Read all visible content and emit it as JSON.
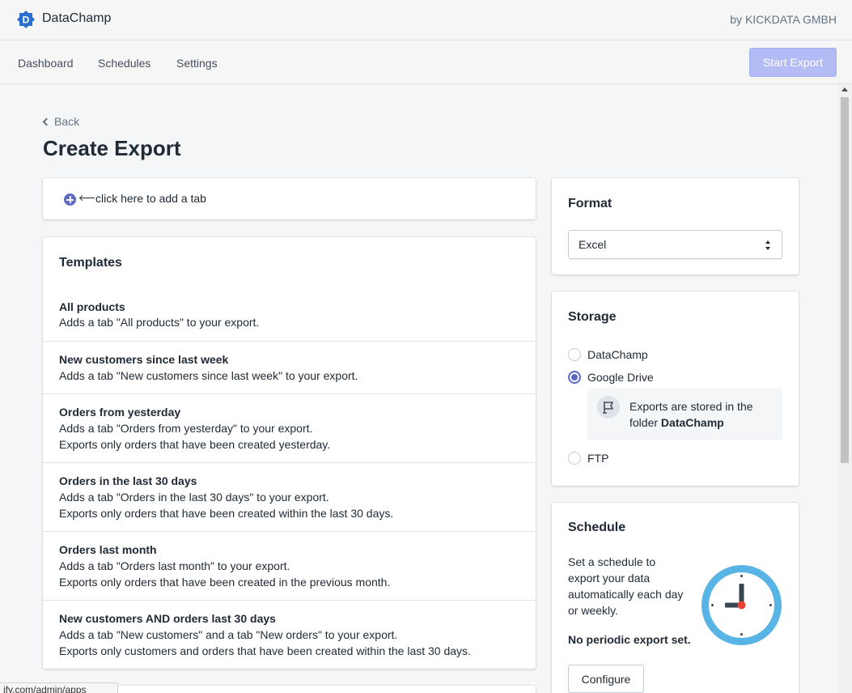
{
  "header": {
    "app_title": "DataChamp",
    "vendor": "by KICKDATA GMBH"
  },
  "nav": {
    "items": [
      {
        "label": "Dashboard"
      },
      {
        "label": "Schedules"
      },
      {
        "label": "Settings"
      }
    ],
    "start_export": "Start Export"
  },
  "page": {
    "back": "Back",
    "title": "Create Export"
  },
  "add_tab": {
    "hint": "click here to add a tab"
  },
  "templates": {
    "title": "Templates",
    "items": [
      {
        "name": "All products",
        "lines": [
          "Adds a tab \"All products\" to your export."
        ]
      },
      {
        "name": "New customers since last week",
        "lines": [
          "Adds a tab \"New customers since last week\" to your export."
        ]
      },
      {
        "name": "Orders from yesterday",
        "lines": [
          "Adds a tab \"Orders from yesterday\" to your export.",
          "Exports only orders that have been created yesterday."
        ]
      },
      {
        "name": "Orders in the last 30 days",
        "lines": [
          "Adds a tab \"Orders in the last 30 days\" to your export.",
          "Exports only orders that have been created within the last 30 days."
        ]
      },
      {
        "name": "Orders last month",
        "lines": [
          "Adds a tab \"Orders last month\" to your export.",
          "Exports only orders that have been created in the previous month."
        ]
      },
      {
        "name": "New customers AND orders last 30 days",
        "lines": [
          "Adds a tab \"New customers\" and a tab \"New orders\" to your export.",
          "Exports only customers and orders that have been created within the last 30 days."
        ]
      }
    ]
  },
  "format": {
    "title": "Format",
    "selected": "Excel"
  },
  "storage": {
    "title": "Storage",
    "options": [
      {
        "label": "DataChamp",
        "checked": false
      },
      {
        "label": "Google Drive",
        "checked": true
      },
      {
        "label": "FTP",
        "checked": false
      }
    ],
    "info_prefix": "Exports are stored in the folder",
    "info_folder": "DataChamp"
  },
  "schedule": {
    "title": "Schedule",
    "description": "Set a schedule to export your data automatically each day or weekly.",
    "status": "No periodic export set.",
    "configure": "Configure"
  },
  "status_bar": {
    "url": "ify.com/admin/apps"
  },
  "colors": {
    "accent": "#5c6ac4",
    "clock_ring": "#58b4e4",
    "clock_dot": "#e94335"
  }
}
